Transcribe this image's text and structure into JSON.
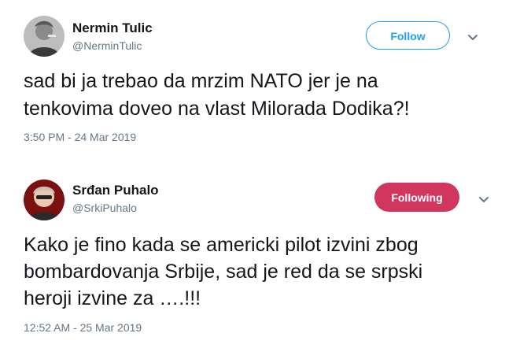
{
  "tweets": [
    {
      "author": {
        "name": "Nermin Tulic",
        "handle": "@NerminTulic"
      },
      "follow_button": {
        "label": "Follow",
        "state": "not-following",
        "color": "#1da1f2"
      },
      "text_lines": [
        "sad bi ja trebao da mrzim NATO jer je na",
        "tenkovima doveo na vlast Milorada Dodika?!"
      ],
      "timestamp": "3:50 PM - 24 Mar 2019"
    },
    {
      "author": {
        "name": "Srđan Puhalo",
        "handle": "@SrkiPuhalo"
      },
      "follow_button": {
        "label": "Following",
        "state": "following",
        "color": "#d1365f"
      },
      "text_lines": [
        "Kako je fino kada se americki pilot izvini zbog",
        "bombardovanja Srbije, sad je red da se srpski",
        "heroji izvine za ….!!!"
      ],
      "timestamp": "12:52 AM - 25 Mar 2019"
    }
  ],
  "icons": {
    "menu": "chevron-down-icon"
  }
}
